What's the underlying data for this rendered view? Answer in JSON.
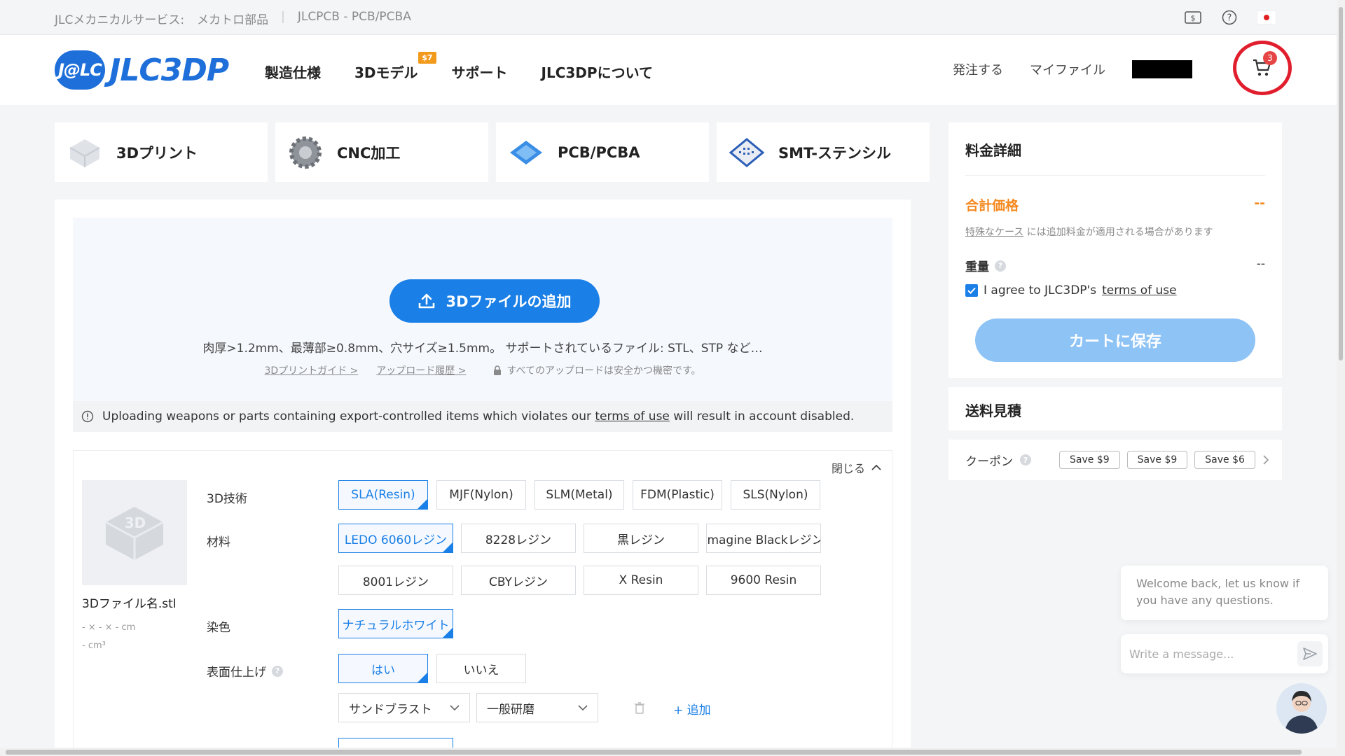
{
  "topbar": {
    "links": [
      "JLCメカニカルサービス:",
      "メカトロ部品",
      "JLCPCB - PCB/PCBA"
    ],
    "icons": [
      "currency-icon",
      "help-icon",
      "flag-icon"
    ]
  },
  "nav": {
    "logo_badge": "J@LC",
    "logo_text": "JLC3DP",
    "menu": [
      "製造仕様",
      "3Dモデル",
      "サポート",
      "JLC3DPについて"
    ],
    "menu_badge": "$7",
    "order": "発注する",
    "my_files": "マイファイル",
    "cart_count": "3"
  },
  "services": [
    {
      "label": "3Dプリント",
      "icon": "3d-print-icon"
    },
    {
      "label": "CNC加工",
      "icon": "cnc-gear-icon"
    },
    {
      "label": "PCB/PCBA",
      "icon": "pcb-icon"
    },
    {
      "label": "SMT-ステンシル",
      "icon": "smt-stencil-icon"
    }
  ],
  "upload": {
    "button": "3Dファイルの追加",
    "note": "肉厚>1.2mm、最薄部≥0.8mm、穴サイズ≥1.5mm。 サポートされているファイル: STL、STP など…",
    "guide_link": "3Dプリントガイド >",
    "history_link": "アップロード履歴 >",
    "secure_text": "すべてのアップロードは安全かつ機密です。"
  },
  "warning": {
    "before": "Uploading weapons or parts containing export-controlled items which violates our",
    "link": "terms of use",
    "after": "will result in account disabled."
  },
  "config": {
    "close": "閉じる",
    "file_name": "3Dファイル名.stl",
    "dims": "- × - × - cm",
    "volume": "- cm³",
    "tech_label": "3D技術",
    "tech_options": [
      "SLA(Resin)",
      "MJF(Nylon)",
      "SLM(Metal)",
      "FDM(Plastic)",
      "SLS(Nylon)"
    ],
    "material_label": "材料",
    "material_options": [
      "LEDO 6060レジン",
      "8228レジン",
      "黒レジン",
      "Imagine Blackレジン",
      "8001レジン",
      "CBYレジン",
      "X Resin",
      "9600 Resin"
    ],
    "color_label": "染色",
    "color_option": "ナチュラルホワイト",
    "finish_label": "表面仕上げ",
    "finish_yes": "はい",
    "finish_no": "いいえ",
    "finish_select_1": "サンドブラスト",
    "finish_select_2": "一般研磨",
    "add": "+ 追加"
  },
  "price": {
    "title": "料金詳細",
    "total_label": "合計価格",
    "total_value": "--",
    "special_link": "特殊なケース",
    "special_text": "には追加料金が適用される場合があります",
    "weight_label": "重量",
    "weight_value": "--",
    "agree_text": "I agree to JLC3DP's",
    "agree_link": "terms of use",
    "save_button": "カートに保存"
  },
  "shipping": {
    "title": "送料見積",
    "coupon_label": "クーポン",
    "coupons": [
      "Save $9",
      "Save $9",
      "Save $6"
    ]
  },
  "chat": {
    "welcome": "Welcome back, let us know if you have any questions.",
    "placeholder": "Write a message..."
  },
  "colors": {
    "primary": "#1a7fe6",
    "accent_orange": "#f5891f",
    "cart_ring": "#e01e2d",
    "save_disabled": "#8ec3f5"
  }
}
